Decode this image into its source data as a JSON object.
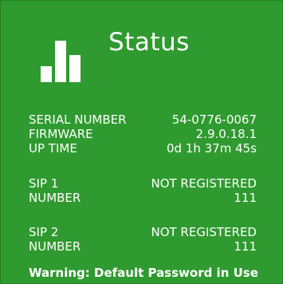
{
  "colors": {
    "background": "#2f9a2f",
    "text": "#ffffff"
  },
  "icon": "bar-chart-icon",
  "title": "Status",
  "device": {
    "serial_label": "SERIAL NUMBER",
    "serial_value": "54-0776-0067",
    "firmware_label": "FIRMWARE",
    "firmware_value": "2.9.0.18.1",
    "uptime_label": "UP TIME",
    "uptime_value": "0d 1h 37m 45s"
  },
  "sip1": {
    "label": "SIP 1",
    "status": "NOT REGISTERED",
    "number_label": "NUMBER",
    "number_value": "111"
  },
  "sip2": {
    "label": "SIP 2",
    "status": "NOT REGISTERED",
    "number_label": "NUMBER",
    "number_value": "111"
  },
  "warning": "Warning: Default Password in Use"
}
